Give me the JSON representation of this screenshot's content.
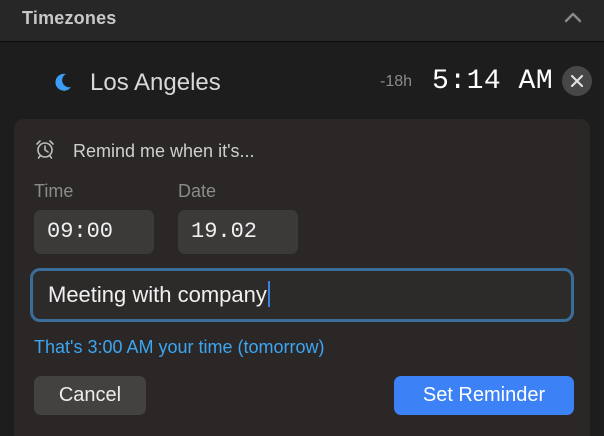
{
  "header": {
    "title": "Timezones",
    "collapse_icon": "chevron-up-icon"
  },
  "timezone": {
    "icon": "moon-icon",
    "city": "Los Angeles",
    "offset": "-18h",
    "time": "5:14 AM",
    "remove_icon": "close-icon"
  },
  "reminder": {
    "icon": "alarm-clock-icon",
    "prompt": "Remind me when it's...",
    "time_label": "Time",
    "time_value": "09:00",
    "date_label": "Date",
    "date_value": "19.02",
    "message_value": "Meeting with company",
    "converted_note": "That's 3:00 AM your time (tomorrow)",
    "cancel_label": "Cancel",
    "submit_label": "Set Reminder"
  },
  "colors": {
    "accent_blue": "#3c82f6",
    "note_blue": "#3ca6f2",
    "focus_ring": "#3a6d99"
  }
}
